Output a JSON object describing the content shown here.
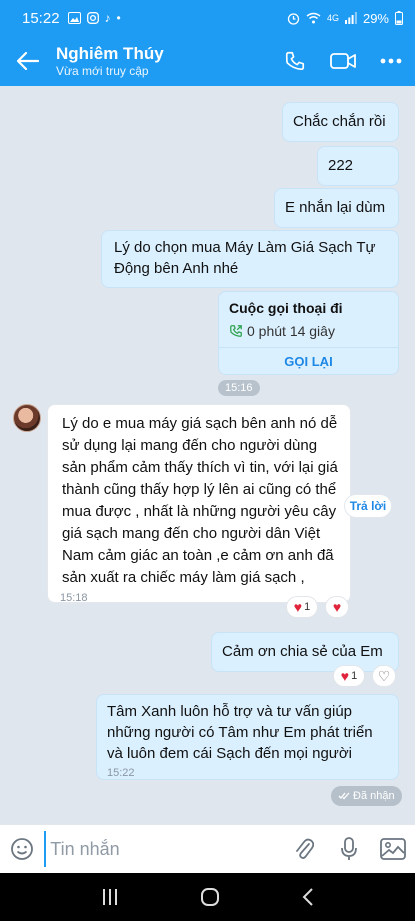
{
  "status_bar": {
    "time": "15:22",
    "network": "4G",
    "battery": "29%"
  },
  "header": {
    "name": "Nghiêm Thúy",
    "status": "Vừa mới truy cập"
  },
  "messages": {
    "m1": "Chắc chắn rồi",
    "m2": "222",
    "m3": "E nhắn lại dùm",
    "m4": "Lý do chọn mua Máy Làm Giá Sạch Tự Động bên Anh nhé",
    "call_title": "Cuộc gọi thoại đi",
    "call_duration": "0 phút 14 giây",
    "call_back": "GỌI LẠI",
    "time1": "15:16",
    "them_text": "Lý do e mua máy giá sạch bên anh nó dễ sử dụng lại mang đến cho người dùng sản phẩm cảm thấy thích vì tin, với lại giá thành cũng thấy hợp lý lên ai cũng có thể mua được , nhất là những người yêu cây giá sạch mang đến cho người dân Việt Nam cảm giác an toàn ,e cảm ơn anh đã sản xuất ra chiếc máy làm giá sạch ,",
    "them_time": "15:18",
    "reply": "Trả lời",
    "reaction_count_1": "1",
    "m5": "Cảm ơn chia sẻ của Em",
    "reaction_count_2": "1",
    "m6": "Tâm Xanh luôn hỗ trợ và tư vấn giúp những người có Tâm như Em phát triển và luôn đem cái Sạch đến mọi người",
    "m6_time": "15:22",
    "sent_status": "Đã nhận"
  },
  "input": {
    "placeholder": "Tin nhắn"
  },
  "colors": {
    "primary": "#1e9bf3",
    "my_bubble": "#dbf0ff",
    "heart": "#e0243b"
  }
}
